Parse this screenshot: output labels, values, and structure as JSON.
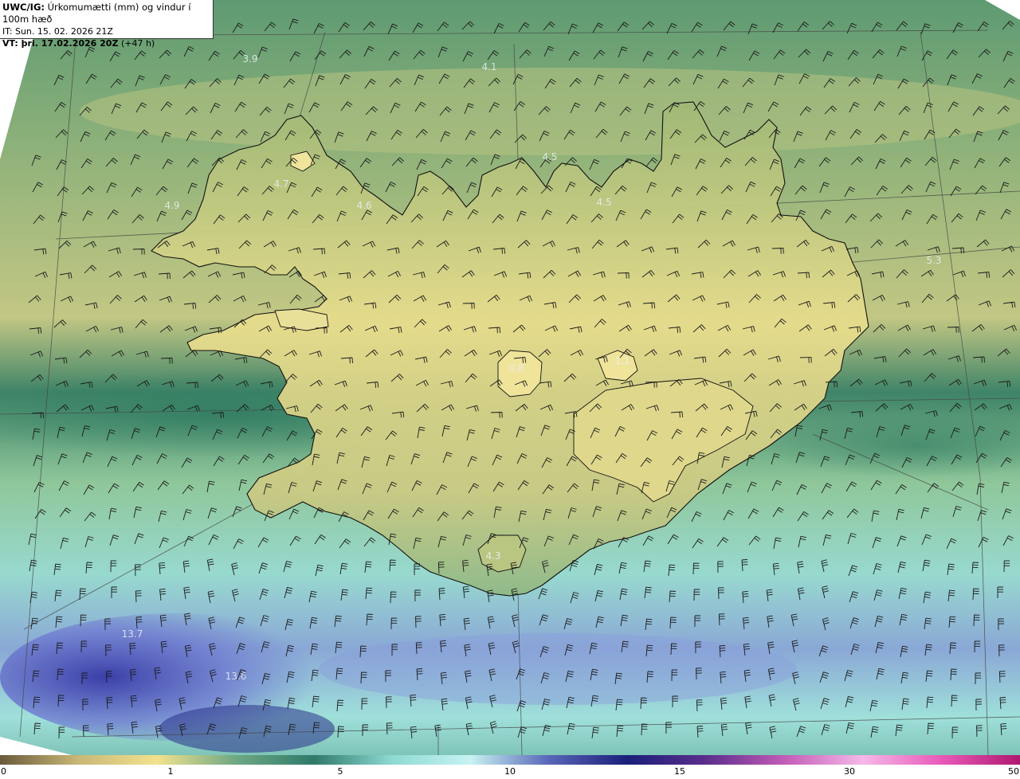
{
  "header": {
    "model_code": "UWC/IG:",
    "title": "Úrkomumætti (mm) og vindur í 100m hæð",
    "initial_time": "IT: Sun. 15. 02. 2026 21Z",
    "valid_time_label": "VT: þri. 17.02.2026 20Z",
    "valid_offset": "(+47 h)"
  },
  "value_labels": [
    {
      "text": "3.9",
      "name": "val-nw-sea"
    },
    {
      "text": "4.1",
      "name": "val-north-sea"
    },
    {
      "text": "4.5",
      "name": "val-skagi"
    },
    {
      "text": "4.7",
      "name": "val-westfjords-east"
    },
    {
      "text": "4.9",
      "name": "val-westfjords-west"
    },
    {
      "text": "4.6",
      "name": "val-hunafloi"
    },
    {
      "text": "4.5",
      "name": "val-trollaskagi"
    },
    {
      "text": "5.3",
      "name": "val-east-sea"
    },
    {
      "text": "0.8",
      "name": "val-langjokull"
    },
    {
      "text": "1.1",
      "name": "val-highlands"
    },
    {
      "text": "4.3",
      "name": "val-myrdalsjokull"
    },
    {
      "text": "13.7",
      "name": "val-sw-sea"
    },
    {
      "text": "13.6",
      "name": "val-south-sea"
    }
  ],
  "colorbar": {
    "ticks": [
      "0",
      "1",
      "5",
      "10",
      "15",
      "30",
      "50"
    ],
    "colors": [
      "#6b5a3c",
      "#c9b877",
      "#f2e28e",
      "#6fa884",
      "#2f7a6a",
      "#8fdad4",
      "#c7f2f2",
      "#5966b8",
      "#1a1f7a",
      "#5b2d8c",
      "#c25cb6",
      "#f5b8e8",
      "#e85ab8",
      "#b0186f"
    ]
  },
  "colors": {
    "land_fill": "#b9c77f",
    "sea_base": "#4f8d6c",
    "barb_color": "#1a1a1a",
    "coast_color": "#111111"
  }
}
